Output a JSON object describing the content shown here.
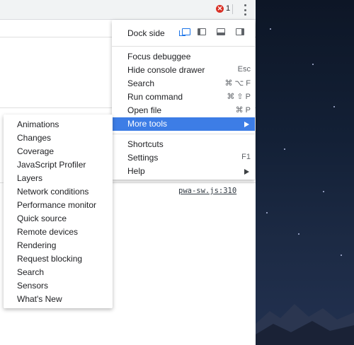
{
  "topbar": {
    "error_count": "1",
    "error_icon": "error-x-icon",
    "more_icon": "kebab-menu-icon"
  },
  "main_menu": {
    "dock_side_label": "Dock side",
    "dock_icons": [
      "undock-icon",
      "dock-left-icon",
      "dock-bottom-icon",
      "dock-right-icon"
    ],
    "items": [
      {
        "label": "Focus debuggee",
        "shortcut": ""
      },
      {
        "label": "Hide console drawer",
        "shortcut": "Esc"
      },
      {
        "label": "Search",
        "shortcut": "⌘ ⌥ F"
      },
      {
        "label": "Run command",
        "shortcut": "⌘ ⇧ P"
      },
      {
        "label": "Open file",
        "shortcut": "⌘ P"
      },
      {
        "label": "More tools",
        "shortcut": "",
        "has_submenu": true,
        "highlighted": true
      },
      {
        "label": "Shortcuts",
        "shortcut": ""
      },
      {
        "label": "Settings",
        "shortcut": "F1"
      },
      {
        "label": "Help",
        "shortcut": "",
        "has_submenu": true
      }
    ]
  },
  "submenu": {
    "items": [
      "Animations",
      "Changes",
      "Coverage",
      "JavaScript Profiler",
      "Layers",
      "Network conditions",
      "Performance monitor",
      "Quick source",
      "Remote devices",
      "Rendering",
      "Request blocking",
      "Search",
      "Sensors",
      "What's New"
    ]
  },
  "console": {
    "source_link": "pwa-sw.js:310"
  },
  "colors": {
    "highlight": "#3d7de6",
    "error": "#d93025",
    "dock_active": "#1a73e8"
  }
}
